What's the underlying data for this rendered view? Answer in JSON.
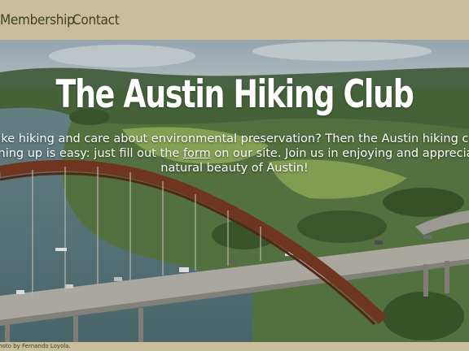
{
  "nav": {
    "links": [
      {
        "label": "Membership"
      },
      {
        "label": "Contact"
      }
    ]
  },
  "hero": {
    "title": "The Austin Hiking Club",
    "text_before_link": "Do you like hiking and care about environmental preservation? Then the Austin hiking club is for you! Signing up is easy: just fill out the ",
    "link_label": "form",
    "text_after_link": " on our site. Join us in enjoying and appreciating the natural beauty of Austin!"
  },
  "footer": {
    "credit": "Photo by Fernando Loyola."
  },
  "colors": {
    "nav_background": "#c9bd9c",
    "nav_text": "#3b4224",
    "hero_text": "#ffffff",
    "bridge_arch": "#7a3a22"
  }
}
